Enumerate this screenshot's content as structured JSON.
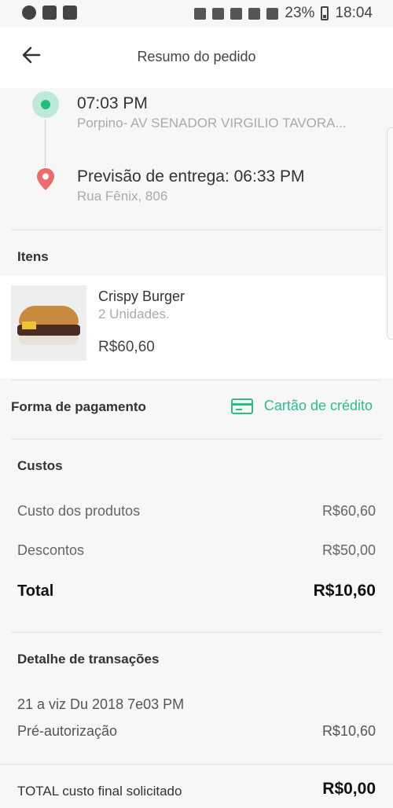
{
  "status_bar": {
    "battery": "23%",
    "time": "18:04"
  },
  "header": {
    "title": "Resumo do pedido"
  },
  "route": {
    "origin_time": "07:03 PM",
    "origin_address": "Porpino- AV SENADOR VIRGILIO TAVORA...",
    "eta": "Previsão de entrega: 06:33 PM",
    "destination_address": "Rua Fênix, 806"
  },
  "items": {
    "section_title": "Itens",
    "list": [
      {
        "name": "Crispy Burger",
        "quantity": "2 Unidades.",
        "price": "R$60,60"
      }
    ]
  },
  "payment": {
    "label": "Forma de pagamento",
    "method": "Cartão de crédito"
  },
  "costs": {
    "section_title": "Custos",
    "products_label": "Custo dos produtos",
    "products_value": "R$60,60",
    "discounts_label": "Descontos",
    "discounts_value": "R$50,00",
    "total_label": "Total",
    "total_value": "R$10,60"
  },
  "transactions": {
    "section_title": "Detalhe de transações",
    "date": "21 a viz Du 2018 7e03 PM",
    "type": "Pré-autorização",
    "amount": "R$10,60"
  },
  "final": {
    "label": "TOTAL custo final solicitado",
    "value": "R$0,00"
  },
  "colors": {
    "accent": "#2bbf85",
    "origin_dot": "#22c07e",
    "pin": "#ee6b6b"
  }
}
